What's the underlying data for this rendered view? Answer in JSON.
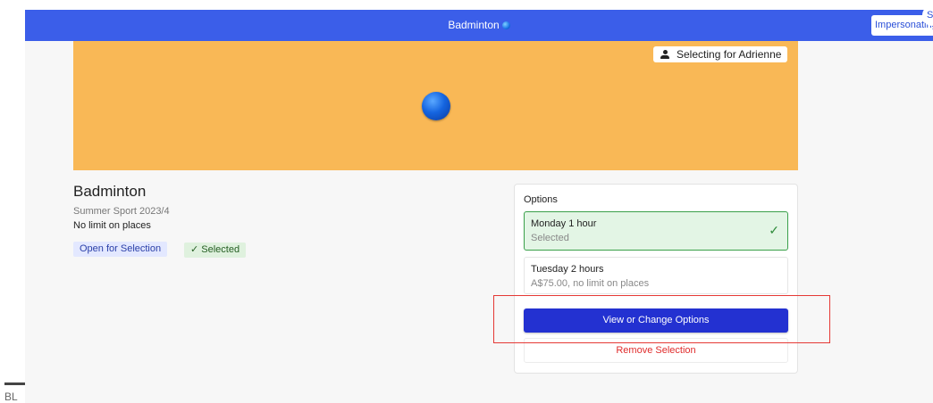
{
  "header": {
    "title": "Badminton",
    "title_icon": "ball-icon",
    "impersonating_label": "Impersonating",
    "avatar_initial": "S"
  },
  "hero": {
    "selecting_for": "Selecting for Adrienne",
    "ball_icon": "ball-icon",
    "background_color": "#f9b856"
  },
  "sport": {
    "name": "Badminton",
    "season": "Summer Sport 2023/4",
    "places": "No limit on places",
    "badges": {
      "open": "Open for Selection",
      "selected": "✓  Selected"
    }
  },
  "options": {
    "heading": "Options",
    "items": [
      {
        "name": "Monday 1 hour",
        "detail": "Selected",
        "selected": true
      },
      {
        "name": "Tuesday 2 hours",
        "detail": "A$75.00, no limit on places",
        "selected": false
      }
    ],
    "view_button": "View or Change Options",
    "remove_link": "Remove Selection"
  },
  "footer": {
    "fragment_text": "BL"
  },
  "colors": {
    "header_bar": "#3b5ee9",
    "primary_button": "#2331d1",
    "selected_green": "#3aa04a",
    "remove_red": "#e02b2b",
    "highlight_red": "#e53935"
  }
}
